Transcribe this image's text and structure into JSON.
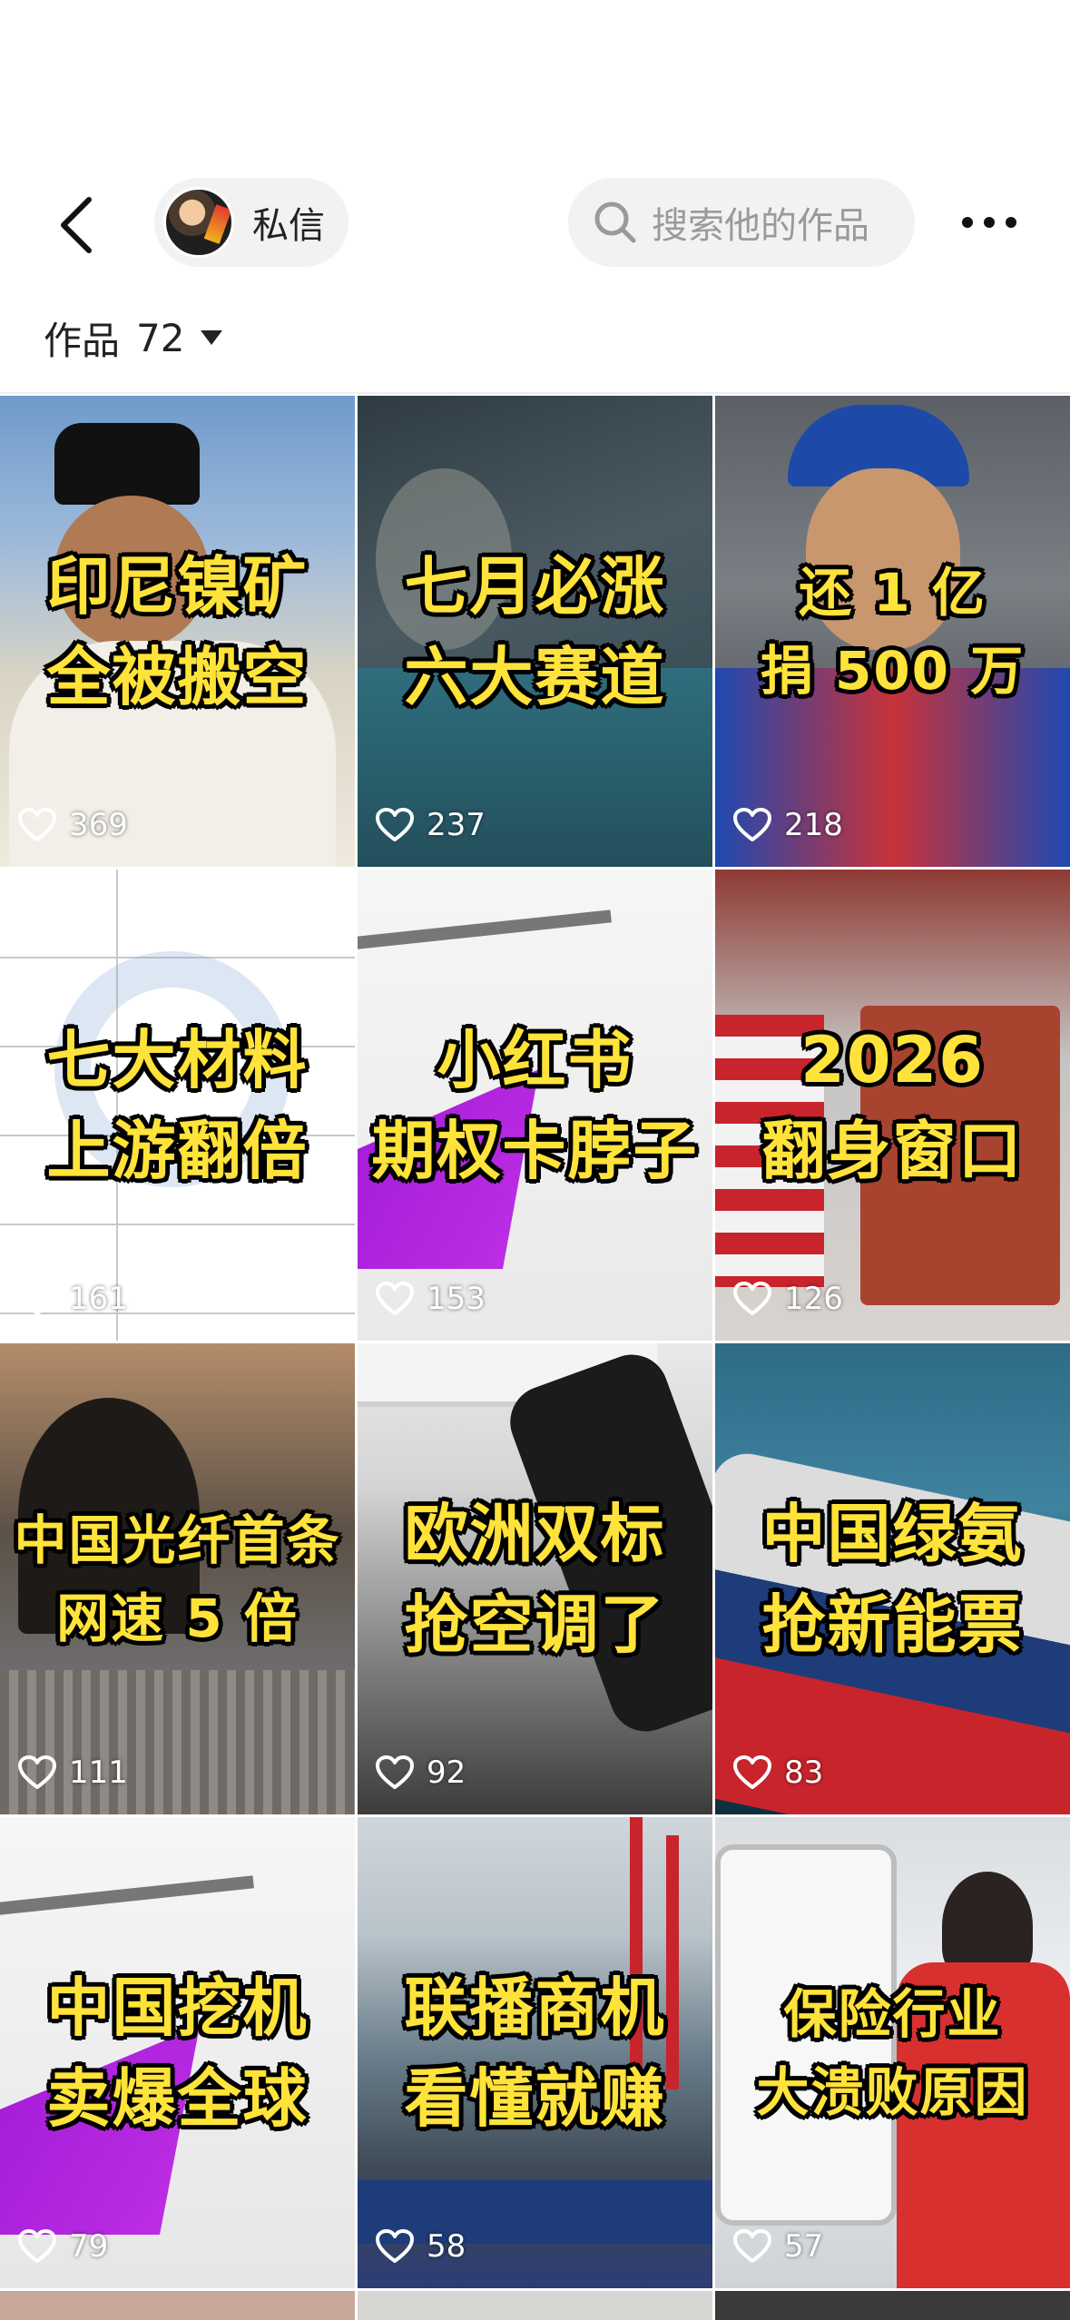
{
  "header": {
    "dm_label": "私信",
    "search_placeholder": "搜索他的作品"
  },
  "works": {
    "label": "作品",
    "count": "72"
  },
  "tiles": [
    {
      "title": "印尼镍矿\n全被搬空",
      "likes": "369"
    },
    {
      "title": "七月必涨\n六大赛道",
      "likes": "237"
    },
    {
      "title": "还 1 亿\n捐 500 万",
      "likes": "218"
    },
    {
      "title": "七大材料\n上游翻倍",
      "likes": "161"
    },
    {
      "title": "小红书\n期权卡脖子",
      "likes": "153"
    },
    {
      "title": "2026\n翻身窗口",
      "likes": "126"
    },
    {
      "title": "中国光纤首条\n网速 5 倍",
      "likes": "111"
    },
    {
      "title": "欧洲双标\n抢空调了",
      "likes": "92"
    },
    {
      "title": "中国绿氨\n抢新能票",
      "likes": "83"
    },
    {
      "title": "中国挖机\n卖爆全球",
      "likes": "79"
    },
    {
      "title": "联播商机\n看懂就赚",
      "likes": "58"
    },
    {
      "title": "保险行业\n大溃败原因",
      "likes": "57"
    }
  ],
  "colors": {
    "title_yellow": "#ffe33a",
    "pill_bg": "#f2f2f2"
  }
}
